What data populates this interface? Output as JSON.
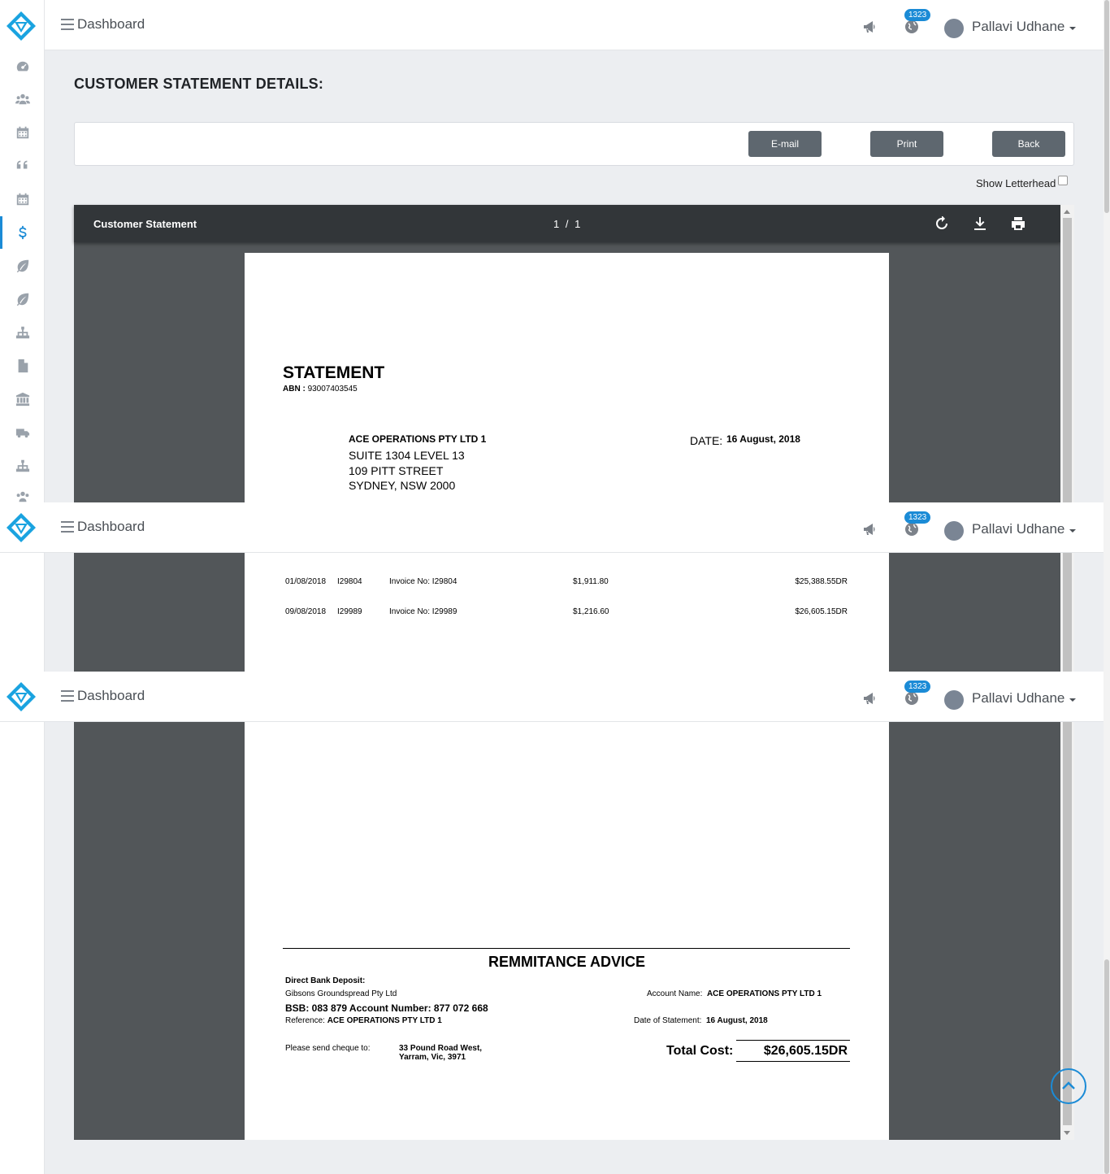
{
  "header": {
    "menu_label": "Dashboard",
    "notification_count": "1323",
    "user_name": "Pallavi Udhane"
  },
  "page": {
    "title": "CUSTOMER STATEMENT DETAILS:",
    "buttons": {
      "email": "E-mail",
      "print": "Print",
      "back": "Back"
    },
    "show_letterhead_label": "Show Letterhead",
    "show_letterhead_checked": false
  },
  "viewer": {
    "title": "Customer Statement",
    "page_indicator": "1 / 1"
  },
  "statement": {
    "heading": "STATEMENT",
    "abn_label": "ABN :",
    "abn_value": "93007403545",
    "customer_name": "ACE OPERATIONS PTY LTD 1",
    "address_line1": "SUITE 1304 LEVEL 13",
    "address_line2": "109 PITT STREET",
    "address_line3": "SYDNEY, NSW 2000",
    "date_label": "DATE:",
    "date_value": "16 August, 2018",
    "rows": [
      {
        "date": "01/08/2018",
        "ref": "I29804",
        "desc": "Invoice No: I29804",
        "amount": "$1,911.80",
        "balance": "$25,388.55DR"
      },
      {
        "date": "09/08/2018",
        "ref": "I29989",
        "desc": "Invoice No: I29989",
        "amount": "$1,216.60",
        "balance": "$26,605.15DR"
      }
    ]
  },
  "remittance": {
    "heading": "REMMITANCE ADVICE",
    "bank_deposit_label": "Direct Bank Deposit:",
    "company": "Gibsons Groundspread Pty Ltd",
    "bsb_line": "BSB: 083 879 Account Number: 877 072 668",
    "reference_label": "Reference:",
    "reference_value": "ACE OPERATIONS PTY LTD 1",
    "account_name_label": "Account Name:",
    "account_name_value": "ACE OPERATIONS PTY LTD 1",
    "date_of_statement_label": "Date of Statement:",
    "date_of_statement_value": "16 August, 2018",
    "cheque_label": "Please send cheque to:",
    "cheque_line1": "33 Pound Road West,",
    "cheque_line2": "Yarram, Vic, 3971",
    "total_label": "Total Cost:",
    "total_value": "$26,605.15DR"
  },
  "icons": {
    "sidebar": [
      "dashboard-icon",
      "users-icon",
      "calendar-icon",
      "quote-icon",
      "calendar-icon",
      "dollar-icon",
      "leaf-icon",
      "leaf-icon",
      "sitemap-icon",
      "file-icon",
      "bank-icon",
      "truck-icon",
      "sitemap-icon",
      "users-icon"
    ],
    "accent": "#1b8bd6"
  }
}
